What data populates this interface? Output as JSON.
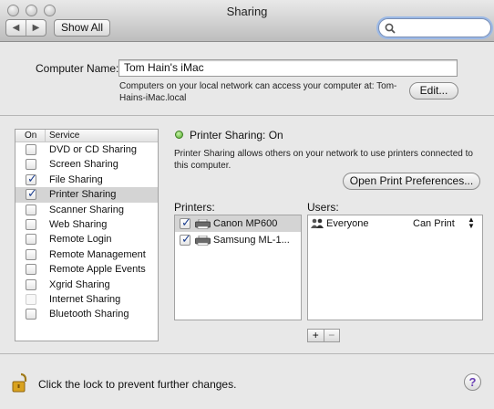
{
  "window": {
    "title": "Sharing"
  },
  "toolbar": {
    "back": "◀",
    "forward": "▶",
    "show_all": "Show All",
    "search_placeholder": ""
  },
  "computer": {
    "label": "Computer Name:",
    "name": "Tom Hain's iMac",
    "description": "Computers on your local network can access your computer at: Tom-Hains-iMac.local",
    "edit_label": "Edit..."
  },
  "services": {
    "header_on": "On",
    "header_service": "Service",
    "items": [
      {
        "label": "DVD or CD Sharing",
        "checked": false,
        "selected": false,
        "dim": false
      },
      {
        "label": "Screen Sharing",
        "checked": false,
        "selected": false,
        "dim": false
      },
      {
        "label": "File Sharing",
        "checked": true,
        "selected": false,
        "dim": false
      },
      {
        "label": "Printer Sharing",
        "checked": true,
        "selected": true,
        "dim": false
      },
      {
        "label": "Scanner Sharing",
        "checked": false,
        "selected": false,
        "dim": false
      },
      {
        "label": "Web Sharing",
        "checked": false,
        "selected": false,
        "dim": false
      },
      {
        "label": "Remote Login",
        "checked": false,
        "selected": false,
        "dim": false
      },
      {
        "label": "Remote Management",
        "checked": false,
        "selected": false,
        "dim": false
      },
      {
        "label": "Remote Apple Events",
        "checked": false,
        "selected": false,
        "dim": false
      },
      {
        "label": "Xgrid Sharing",
        "checked": false,
        "selected": false,
        "dim": false
      },
      {
        "label": "Internet Sharing",
        "checked": false,
        "selected": false,
        "dim": true
      },
      {
        "label": "Bluetooth Sharing",
        "checked": false,
        "selected": false,
        "dim": false
      }
    ]
  },
  "detail": {
    "status": "Printer Sharing: On",
    "description": "Printer Sharing allows others on your network to use printers connected to this computer.",
    "open_prefs_label": "Open Print Preferences...",
    "printers_label": "Printers:",
    "users_label": "Users:",
    "printers": [
      {
        "label": "Canon MP600",
        "checked": true,
        "selected": true
      },
      {
        "label": "Samsung ML-1...",
        "checked": true,
        "selected": false
      }
    ],
    "users": [
      {
        "name": "Everyone",
        "permission": "Can Print"
      }
    ],
    "add_label": "+",
    "remove_label": "−"
  },
  "footer": {
    "lock_text": "Click the lock to prevent further changes.",
    "help_label": "?"
  },
  "colors": {
    "status_on": "#4fa82a",
    "checkmark": "#1d3f8f",
    "selection": "#d4d4d4"
  }
}
